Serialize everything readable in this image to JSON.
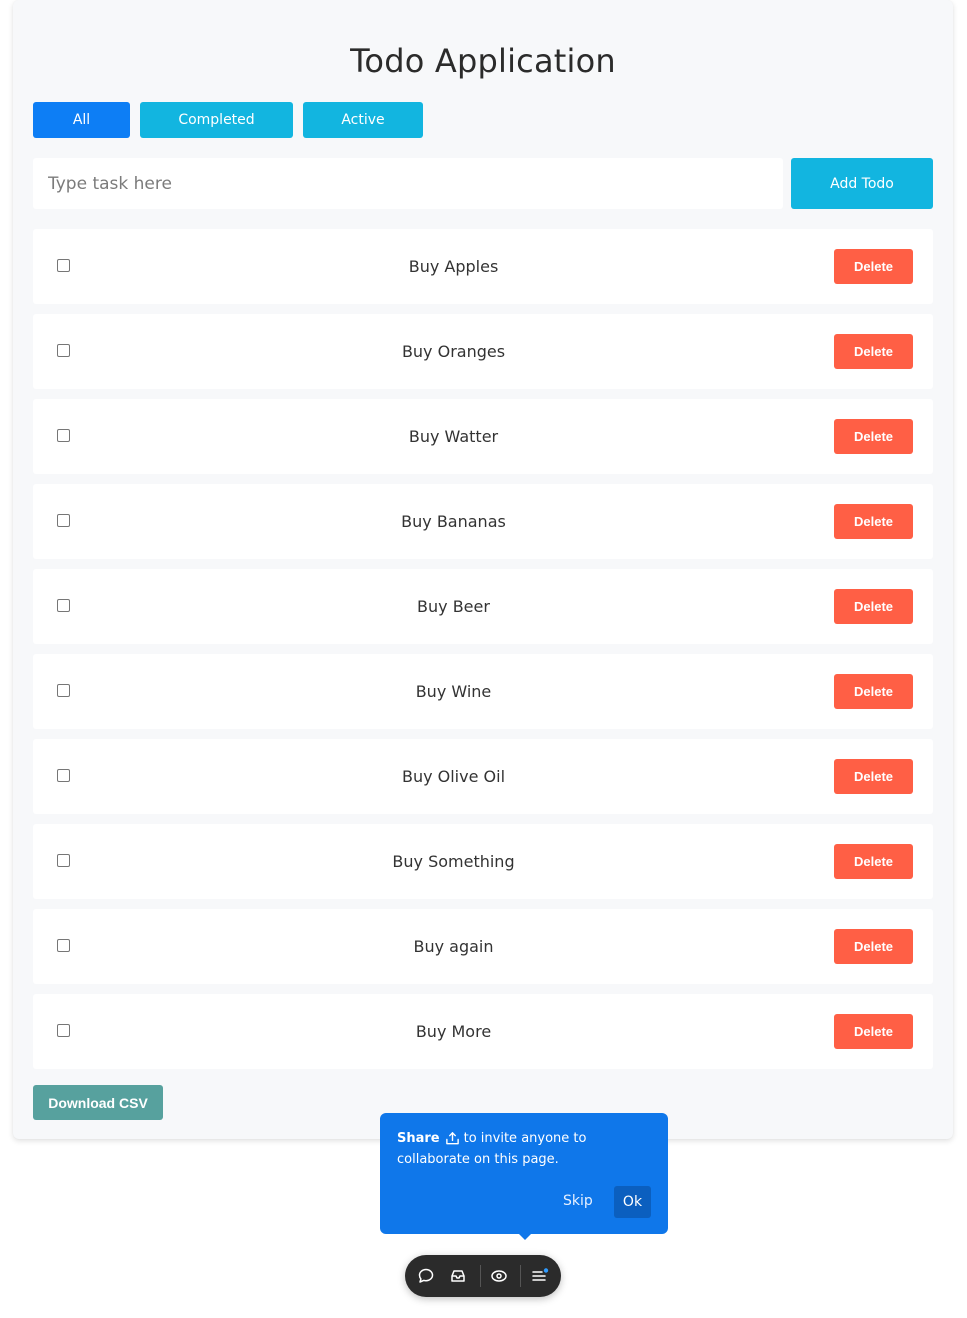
{
  "app": {
    "title": "Todo Application"
  },
  "filters": {
    "all": "All",
    "completed": "Completed",
    "active": "Active"
  },
  "new_task": {
    "placeholder": "Type task here",
    "value": "",
    "add_label": "Add Todo"
  },
  "todos": [
    {
      "text": "Buy Apples",
      "checked": false,
      "delete_label": "Delete"
    },
    {
      "text": "Buy Oranges",
      "checked": false,
      "delete_label": "Delete"
    },
    {
      "text": "Buy Watter",
      "checked": false,
      "delete_label": "Delete"
    },
    {
      "text": "Buy Bananas",
      "checked": false,
      "delete_label": "Delete"
    },
    {
      "text": "Buy Beer",
      "checked": false,
      "delete_label": "Delete"
    },
    {
      "text": "Buy Wine",
      "checked": false,
      "delete_label": "Delete"
    },
    {
      "text": "Buy Olive Oil",
      "checked": false,
      "delete_label": "Delete"
    },
    {
      "text": "Buy Something",
      "checked": false,
      "delete_label": "Delete"
    },
    {
      "text": "Buy again",
      "checked": false,
      "delete_label": "Delete"
    },
    {
      "text": "Buy More",
      "checked": false,
      "delete_label": "Delete"
    }
  ],
  "footer": {
    "download_label": "Download CSV"
  },
  "share_tooltip": {
    "strong": "Share",
    "line1_rest": "to invite anyone to",
    "line2": "collaborate on this page.",
    "skip_label": "Skip",
    "ok_label": "Ok"
  },
  "toolbar_icons": [
    "comment-icon",
    "inbox-icon",
    "eye-icon",
    "menu-icon"
  ],
  "colors": {
    "primary": "#0d7ef5",
    "info": "#12b5e0",
    "danger": "#ff5f45",
    "csv": "#57a19e",
    "tooltip": "#0f77ea",
    "toolbar": "#2b2b2b",
    "notify_dot": "#2f9bff"
  }
}
